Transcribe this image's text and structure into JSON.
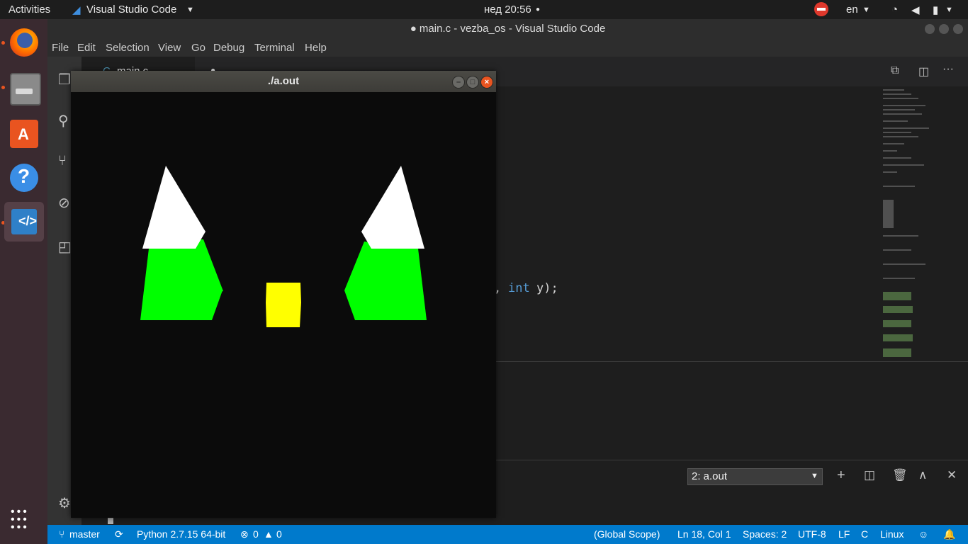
{
  "topbar": {
    "activities": "Activities",
    "app_name": "Visual Studio Code",
    "clock": "нед 20:56",
    "keyboard_layout": "en"
  },
  "vscode": {
    "window_title": "● main.c - vezba_os - Visual Studio Code",
    "menu": [
      "File",
      "Edit",
      "Selection",
      "View",
      "Go",
      "Debug",
      "Terminal",
      "Help"
    ],
    "tab_label": "main.c",
    "code_fragment_kw": "int",
    "code_fragment_rest": "y);",
    "code_fragment_comma": ",",
    "terminal_select": "2: a.out"
  },
  "xwindow": {
    "title": "./a.out"
  },
  "statusbar": {
    "branch": "master",
    "python": "Python 2.7.15 64-bit",
    "errors": "0",
    "warnings": "0",
    "scope": "(Global Scope)",
    "position": "Ln 18, Col 1",
    "spaces": "Spaces: 2",
    "encoding": "UTF-8",
    "eol": "LF",
    "language": "C",
    "platform": "Linux"
  },
  "colors": {
    "accent": "#007acc",
    "green": "#00ff00",
    "yellow": "#ffff00",
    "white": "#ffffff",
    "ubuntu_orange": "#e95420"
  }
}
